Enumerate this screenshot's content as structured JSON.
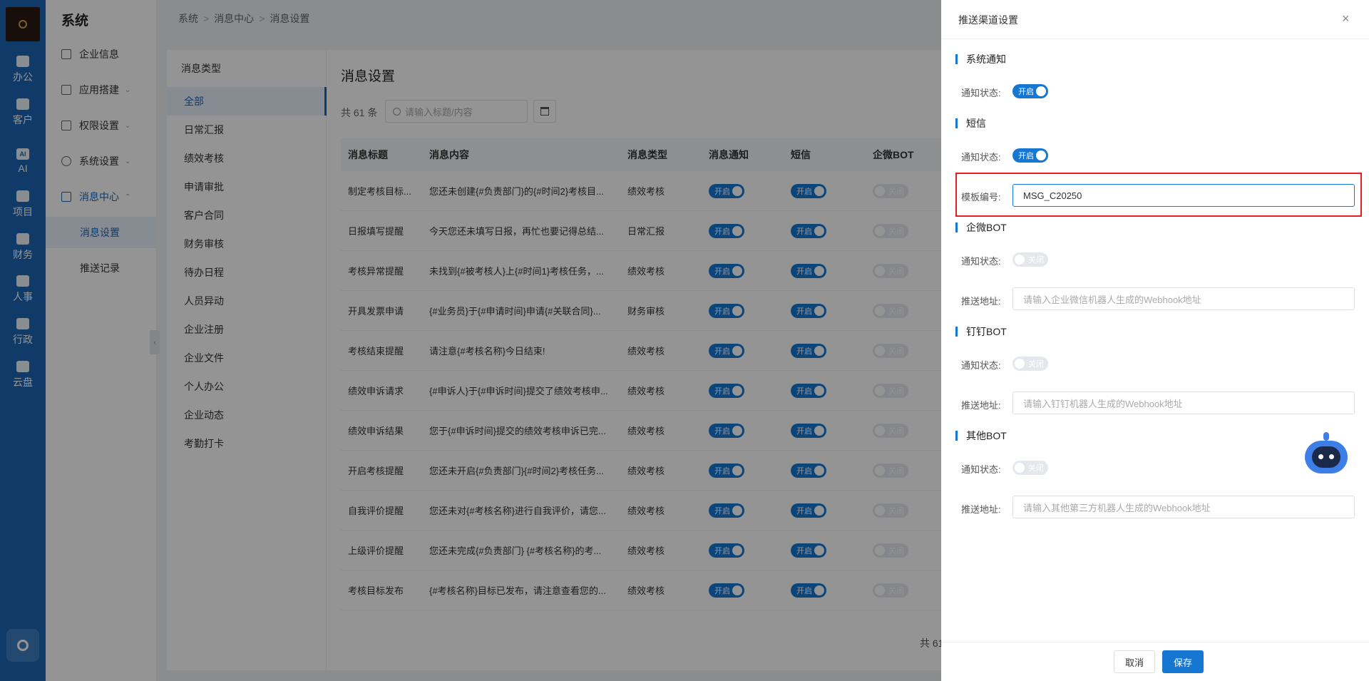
{
  "rail": {
    "items": [
      {
        "label": "办公",
        "icon": "briefcase-icon"
      },
      {
        "label": "客户",
        "icon": "user-icon"
      },
      {
        "label": "AI",
        "icon": "ai-icon"
      },
      {
        "label": "项目",
        "icon": "folder-icon"
      },
      {
        "label": "财务",
        "icon": "money-bag-icon"
      },
      {
        "label": "人事",
        "icon": "id-card-icon"
      },
      {
        "label": "行政",
        "icon": "contact-icon"
      },
      {
        "label": "云盘",
        "icon": "cloud-drive-icon"
      }
    ],
    "ai_glyph": "AI"
  },
  "sidebar": {
    "title": "系统",
    "items": [
      {
        "label": "企业信息"
      },
      {
        "label": "应用搭建",
        "chevron": "⌄"
      },
      {
        "label": "权限设置",
        "chevron": "⌄"
      },
      {
        "label": "系统设置",
        "chevron": "⌄"
      },
      {
        "label": "消息中心",
        "chevron": "⌃"
      }
    ],
    "sub_items": [
      {
        "label": "消息设置"
      },
      {
        "label": "推送记录"
      }
    ]
  },
  "breadcrumb": [
    "系统",
    "消息中心",
    "消息设置"
  ],
  "breadcrumb_sep": ">",
  "collapse_glyph": "‹",
  "types": {
    "header": "消息类型",
    "items": [
      "全部",
      "日常汇报",
      "绩效考核",
      "申请审批",
      "客户合同",
      "财务审核",
      "待办日程",
      "人员异动",
      "企业注册",
      "企业文件",
      "个人办公",
      "企业动态",
      "考勤打卡"
    ]
  },
  "content": {
    "title": "消息设置",
    "count": "共 61 条",
    "search_placeholder": "请输入标题/内容",
    "columns": [
      "消息标题",
      "消息内容",
      "消息类型",
      "消息通知",
      "短信",
      "企微BOT"
    ],
    "rows": [
      {
        "title": "制定考核目标...",
        "content": "您还未创建{#负责部门}的{#时间2}考核目...",
        "type": "绩效考核"
      },
      {
        "title": "日报填写提醒",
        "content": "今天您还未填写日报，再忙也要记得总结...",
        "type": "日常汇报"
      },
      {
        "title": "考核异常提醒",
        "content": "未找到{#被考核人}上{#时间1}考核任务，...",
        "type": "绩效考核"
      },
      {
        "title": "开具发票申请",
        "content": "{#业务员}于{#申请时间}申请{#关联合同}...",
        "type": "财务审核"
      },
      {
        "title": "考核结束提醒",
        "content": "请注意{#考核名称}今日结束!",
        "type": "绩效考核"
      },
      {
        "title": "绩效申诉请求",
        "content": "{#申诉人}于{#申诉时间}提交了绩效考核申...",
        "type": "绩效考核"
      },
      {
        "title": "绩效申诉结果",
        "content": "您于{#申诉时间}提交的绩效考核申诉已完...",
        "type": "绩效考核"
      },
      {
        "title": "开启考核提醒",
        "content": "您还未开启{#负责部门}{#时间2}考核任务...",
        "type": "绩效考核"
      },
      {
        "title": "自我评价提醒",
        "content": "您还未对{#考核名称}进行自我评价，请您...",
        "type": "绩效考核"
      },
      {
        "title": "上级评价提醒",
        "content": "您还未完成{#负责部门} {#考核名称}的考...",
        "type": "绩效考核"
      },
      {
        "title": "考核目标发布",
        "content": "{#考核名称}目标已发布，请注意查看您的...",
        "type": "绩效考核"
      }
    ],
    "switch_on": "开启",
    "switch_off": "关闭",
    "total": "共 61"
  },
  "drawer": {
    "title": "推送渠道设置",
    "close": "×",
    "status_label": "通知状态:",
    "on": "开启",
    "off": "关闭",
    "sections": {
      "system": {
        "title": "系统通知"
      },
      "sms": {
        "title": "短信",
        "template_label": "模板编号:",
        "template_value": "MSG_C20250"
      },
      "wecom": {
        "title": "企微BOT",
        "addr_label": "推送地址:",
        "placeholder": "请输入企业微信机器人生成的Webhook地址"
      },
      "dingtalk": {
        "title": "钉钉BOT",
        "addr_label": "推送地址:",
        "placeholder": "请输入钉钉机器人生成的Webhook地址"
      },
      "other": {
        "title": "其他BOT",
        "addr_label": "推送地址:",
        "placeholder": "请输入其他第三方机器人生成的Webhook地址"
      }
    },
    "cancel": "取消",
    "save": "保存"
  },
  "colors": {
    "primary": "#1677d2",
    "rail": "#1d67b5",
    "highlight": "#e02020"
  }
}
